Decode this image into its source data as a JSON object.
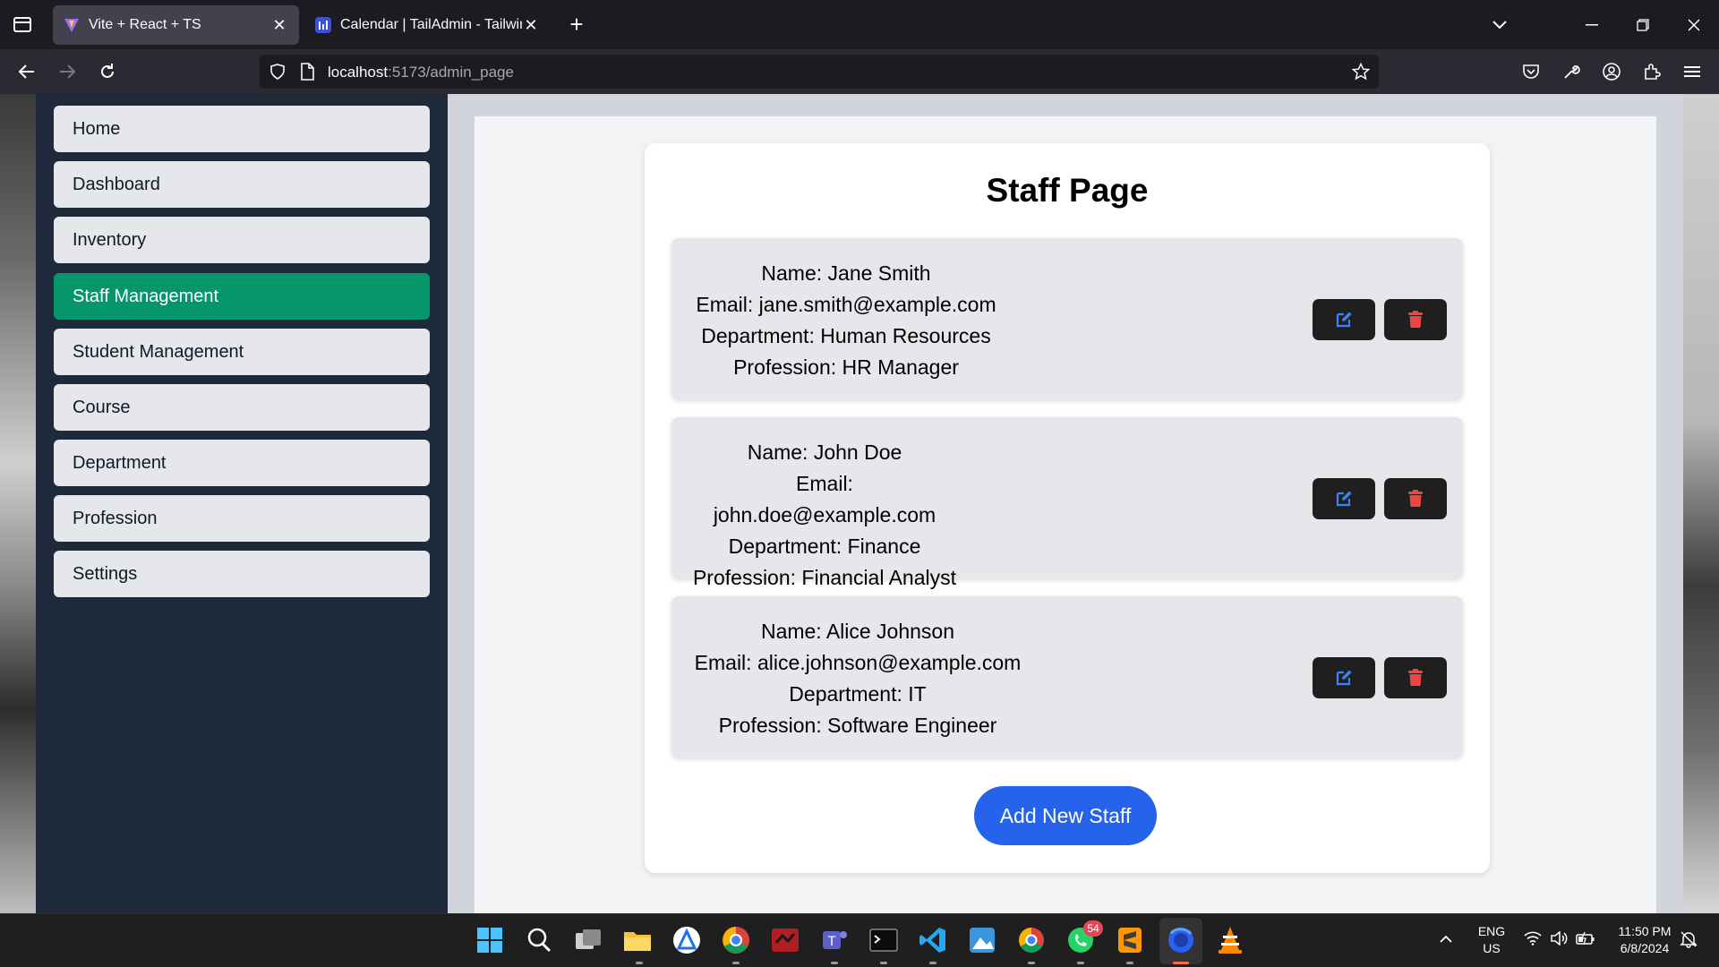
{
  "browser": {
    "tabs": [
      {
        "title": "Vite + React + TS",
        "active": true
      },
      {
        "title": "Calendar | TailAdmin - Tailwind",
        "active": false
      }
    ],
    "url_host": "localhost",
    "url_path": ":5173/admin_page"
  },
  "sidebar": {
    "items": [
      {
        "label": "Home"
      },
      {
        "label": "Dashboard"
      },
      {
        "label": "Inventory"
      },
      {
        "label": "Staff Management",
        "active": true
      },
      {
        "label": "Student Management"
      },
      {
        "label": "Course"
      },
      {
        "label": "Department"
      },
      {
        "label": "Profession"
      },
      {
        "label": "Settings"
      }
    ]
  },
  "main": {
    "title": "Staff Page",
    "staff": [
      {
        "name": "Name: Jane Smith",
        "email": "Email: jane.smith@example.com",
        "department": "Department: Human Resources",
        "profession": "Profession: HR Manager"
      },
      {
        "name": "Name: John Doe",
        "email": "Email: john.doe@example.com",
        "department": "Department: Finance",
        "profession": "Profession: Financial Analyst"
      },
      {
        "name": "Name: Alice Johnson",
        "email": "Email: alice.johnson@example.com",
        "department": "Department: IT",
        "profession": "Profession: Software Engineer"
      }
    ],
    "add_button": "Add New Staff"
  },
  "colors": {
    "sidebar_bg": "#1e293b",
    "active_item": "#059669",
    "primary_button": "#2563eb",
    "edit_icon": "#3b82f6",
    "delete_icon": "#ef4444"
  },
  "taskbar": {
    "whatsapp_badge": "54",
    "language": "ENG",
    "region": "US",
    "time": "11:50 PM",
    "date": "6/8/2024"
  }
}
